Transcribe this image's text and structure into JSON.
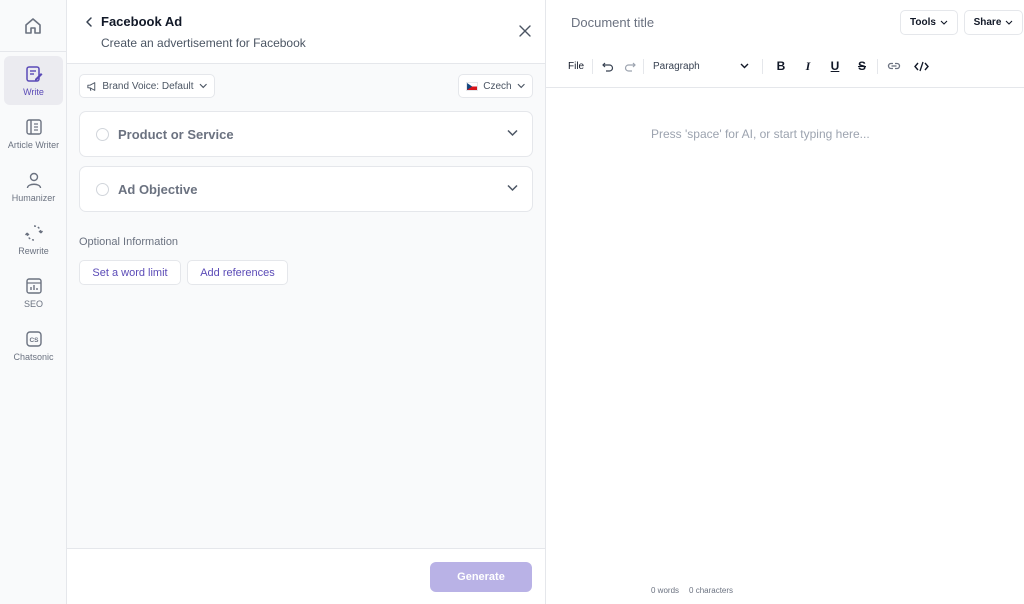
{
  "sidebar": {
    "items": [
      {
        "label": "Write"
      },
      {
        "label": "Article Writer"
      },
      {
        "label": "Humanizer"
      },
      {
        "label": "Rewrite"
      },
      {
        "label": "SEO"
      },
      {
        "label": "Chatsonic"
      }
    ]
  },
  "panel": {
    "title": "Facebook Ad",
    "subtitle": "Create an advertisement for Facebook",
    "brand_voice": "Brand Voice: Default",
    "language": "Czech",
    "fields": [
      {
        "label": "Product or Service"
      },
      {
        "label": "Ad Objective"
      }
    ],
    "optional_label": "Optional Information",
    "word_limit": "Set a word limit",
    "add_references": "Add references",
    "generate": "Generate"
  },
  "editor": {
    "doc_title_placeholder": "Document title",
    "tools": "Tools",
    "share": "Share",
    "file": "File",
    "paragraph": "Paragraph",
    "bold": "B",
    "italic": "I",
    "underline": "U",
    "strike": "S",
    "placeholder": "Press 'space' for AI, or start typing here...",
    "words": "0 words",
    "characters": "0 characters"
  },
  "colors": {
    "accent": "#5b4bb7",
    "generate_bg": "#b9b2e6"
  }
}
